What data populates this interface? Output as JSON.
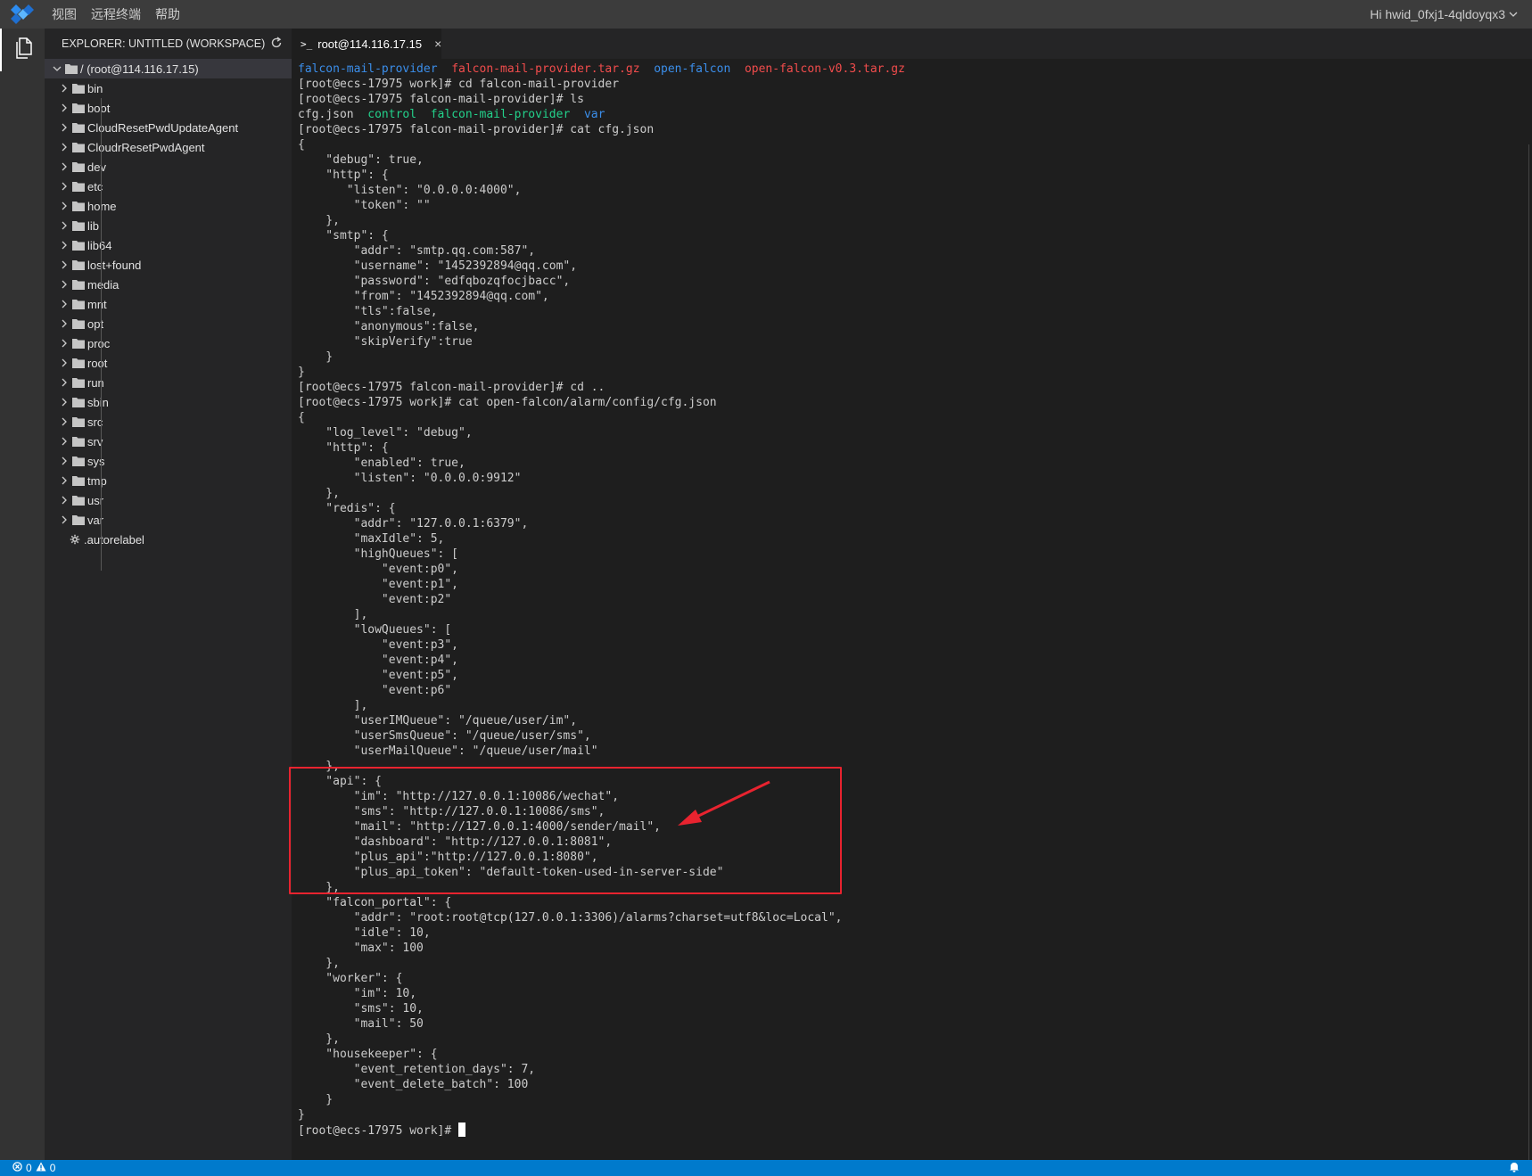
{
  "menubar": {
    "items": [
      "视图",
      "远程终端",
      "帮助"
    ],
    "account": "Hi hwid_0fxj1-4qldoyqx3"
  },
  "sidebar": {
    "title": "EXPLORER: UNTITLED (WORKSPACE)",
    "root": "/ (root@114.116.17.15)",
    "folders": [
      "bin",
      "boot",
      "CloudResetPwdUpdateAgent",
      "CloudrResetPwdAgent",
      "dev",
      "etc",
      "home",
      "lib",
      "lib64",
      "lost+found",
      "media",
      "mnt",
      "opt",
      "proc",
      "root",
      "run",
      "sbin",
      "src",
      "srv",
      "sys",
      "tmp",
      "usr",
      "var"
    ],
    "files": [
      ".autorelabel"
    ]
  },
  "tab": {
    "label": "root@114.116.17.15",
    "icon": ">_"
  },
  "colors": {
    "blue": "#3b8eea",
    "red": "#f14c4c",
    "green": "#23d18b",
    "accent": "#007acc",
    "annotation": "#e8232f"
  },
  "terminal": {
    "lines": [
      [
        {
          "t": "falcon-mail-provider",
          "c": "blue"
        },
        {
          "t": "  "
        },
        {
          "t": "falcon-mail-provider.tar.gz",
          "c": "red"
        },
        {
          "t": "  "
        },
        {
          "t": "open-falcon",
          "c": "blue"
        },
        {
          "t": "  "
        },
        {
          "t": "open-falcon-v0.3.tar.gz",
          "c": "red"
        }
      ],
      [
        {
          "t": "[root@ecs-17975 work]# cd falcon-mail-provider"
        }
      ],
      [
        {
          "t": "[root@ecs-17975 falcon-mail-provider]# ls"
        }
      ],
      [
        {
          "t": "cfg.json  "
        },
        {
          "t": "control",
          "c": "green"
        },
        {
          "t": "  "
        },
        {
          "t": "falcon-mail-provider",
          "c": "green"
        },
        {
          "t": "  "
        },
        {
          "t": "var",
          "c": "blue"
        }
      ],
      [
        {
          "t": "[root@ecs-17975 falcon-mail-provider]# cat cfg.json"
        }
      ],
      [
        {
          "t": "{"
        }
      ],
      [
        {
          "t": "    \"debug\": true,"
        }
      ],
      [
        {
          "t": "    \"http\": {"
        }
      ],
      [
        {
          "t": "       \"listen\": \"0.0.0.0:4000\","
        }
      ],
      [
        {
          "t": "        \"token\": \"\""
        }
      ],
      [
        {
          "t": "    },"
        }
      ],
      [
        {
          "t": "    \"smtp\": {"
        }
      ],
      [
        {
          "t": "        \"addr\": \"smtp.qq.com:587\","
        }
      ],
      [
        {
          "t": "        \"username\": \"1452392894@qq.com\","
        }
      ],
      [
        {
          "t": "        \"password\": \"edfqbozqfocjbacc\","
        }
      ],
      [
        {
          "t": "        \"from\": \"1452392894@qq.com\","
        }
      ],
      [
        {
          "t": "        \"tls\":false,"
        }
      ],
      [
        {
          "t": "        \"anonymous\":false,"
        }
      ],
      [
        {
          "t": "        \"skipVerify\":true"
        }
      ],
      [
        {
          "t": "    }"
        }
      ],
      [
        {
          "t": "}"
        }
      ],
      [
        {
          "t": "[root@ecs-17975 falcon-mail-provider]# cd .."
        }
      ],
      [
        {
          "t": "[root@ecs-17975 work]# cat open-falcon/alarm/config/cfg.json"
        }
      ],
      [
        {
          "t": "{"
        }
      ],
      [
        {
          "t": "    \"log_level\": \"debug\","
        }
      ],
      [
        {
          "t": "    \"http\": {"
        }
      ],
      [
        {
          "t": "        \"enabled\": true,"
        }
      ],
      [
        {
          "t": "        \"listen\": \"0.0.0.0:9912\""
        }
      ],
      [
        {
          "t": "    },"
        }
      ],
      [
        {
          "t": "    \"redis\": {"
        }
      ],
      [
        {
          "t": "        \"addr\": \"127.0.0.1:6379\","
        }
      ],
      [
        {
          "t": "        \"maxIdle\": 5,"
        }
      ],
      [
        {
          "t": "        \"highQueues\": ["
        }
      ],
      [
        {
          "t": "            \"event:p0\","
        }
      ],
      [
        {
          "t": "            \"event:p1\","
        }
      ],
      [
        {
          "t": "            \"event:p2\""
        }
      ],
      [
        {
          "t": "        ],"
        }
      ],
      [
        {
          "t": "        \"lowQueues\": ["
        }
      ],
      [
        {
          "t": "            \"event:p3\","
        }
      ],
      [
        {
          "t": "            \"event:p4\","
        }
      ],
      [
        {
          "t": "            \"event:p5\","
        }
      ],
      [
        {
          "t": "            \"event:p6\""
        }
      ],
      [
        {
          "t": "        ],"
        }
      ],
      [
        {
          "t": "        \"userIMQueue\": \"/queue/user/im\","
        }
      ],
      [
        {
          "t": "        \"userSmsQueue\": \"/queue/user/sms\","
        }
      ],
      [
        {
          "t": "        \"userMailQueue\": \"/queue/user/mail\""
        }
      ],
      [
        {
          "t": "    },"
        }
      ],
      [
        {
          "t": "    \"api\": {"
        }
      ],
      [
        {
          "t": "        \"im\": \"http://127.0.0.1:10086/wechat\","
        }
      ],
      [
        {
          "t": "        \"sms\": \"http://127.0.0.1:10086/sms\","
        }
      ],
      [
        {
          "t": "        \"mail\": \"http://127.0.0.1:4000/sender/mail\","
        }
      ],
      [
        {
          "t": "        \"dashboard\": \"http://127.0.0.1:8081\","
        }
      ],
      [
        {
          "t": "        \"plus_api\":\"http://127.0.0.1:8080\","
        }
      ],
      [
        {
          "t": "        \"plus_api_token\": \"default-token-used-in-server-side\""
        }
      ],
      [
        {
          "t": "    },"
        }
      ],
      [
        {
          "t": "    \"falcon_portal\": {"
        }
      ],
      [
        {
          "t": "        \"addr\": \"root:root@tcp(127.0.0.1:3306)/alarms?charset=utf8&loc=Local\","
        }
      ],
      [
        {
          "t": "        \"idle\": 10,"
        }
      ],
      [
        {
          "t": "        \"max\": 100"
        }
      ],
      [
        {
          "t": "    },"
        }
      ],
      [
        {
          "t": "    \"worker\": {"
        }
      ],
      [
        {
          "t": "        \"im\": 10,"
        }
      ],
      [
        {
          "t": "        \"sms\": 10,"
        }
      ],
      [
        {
          "t": "        \"mail\": 50"
        }
      ],
      [
        {
          "t": "    },"
        }
      ],
      [
        {
          "t": "    \"housekeeper\": {"
        }
      ],
      [
        {
          "t": "        \"event_retention_days\": 7,"
        }
      ],
      [
        {
          "t": "        \"event_delete_batch\": 100"
        }
      ],
      [
        {
          "t": "    }"
        }
      ],
      [
        {
          "t": "}"
        }
      ],
      [
        {
          "t": "[root@ecs-17975 work]# "
        }
      ]
    ]
  },
  "statusbar": {
    "errors": "0",
    "warnings": "0"
  }
}
